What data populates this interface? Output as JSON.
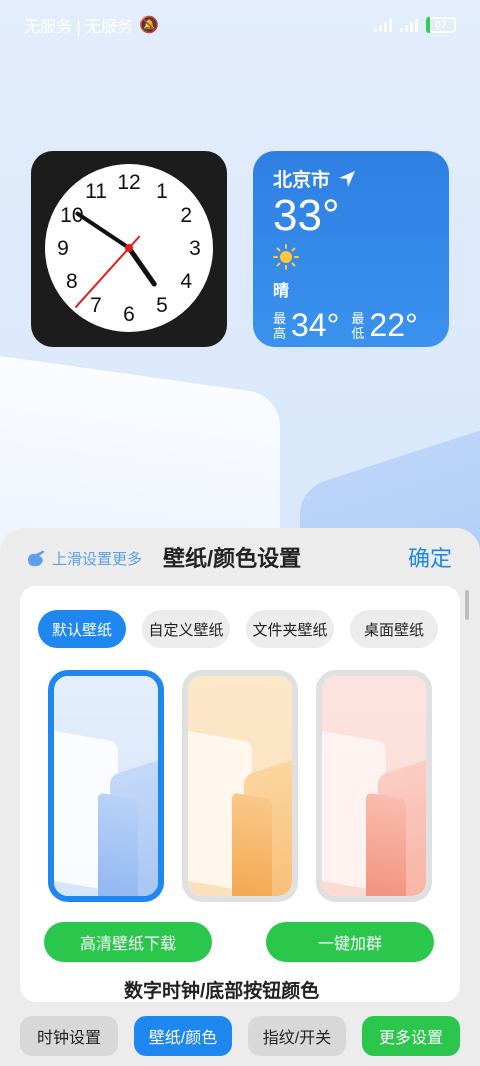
{
  "status_bar": {
    "carrier_text": "无服务 | 无服务",
    "battery": "07"
  },
  "clock_widget": {
    "numerals": [
      "12",
      "1",
      "2",
      "3",
      "4",
      "5",
      "6",
      "7",
      "8",
      "9",
      "10",
      "11"
    ],
    "time": {
      "hour": 4,
      "minute": 50,
      "second": 37
    }
  },
  "weather_widget": {
    "city": "北京市",
    "temperature": "33°",
    "condition": "晴",
    "high_label": "最高",
    "high": "34°",
    "low_label": "最低",
    "low": "22°"
  },
  "panel": {
    "hint": "上滑设置更多",
    "title": "壁纸/颜色设置",
    "confirm": "确定",
    "tabs": [
      {
        "label": "默认壁纸",
        "active": true
      },
      {
        "label": "自定义壁纸",
        "active": false
      },
      {
        "label": "文件夹壁纸",
        "active": false
      },
      {
        "label": "桌面壁纸",
        "active": false
      }
    ],
    "wallpapers": [
      {
        "theme": "blue",
        "selected": true
      },
      {
        "theme": "orange",
        "selected": false
      },
      {
        "theme": "pink",
        "selected": false
      }
    ],
    "download_button": "高清壁纸下载",
    "join_group_button": "一键加群",
    "next_section": "数字时钟/底部按钮颜色"
  },
  "bottom_nav": [
    {
      "label": "时钟设置",
      "style": "gray"
    },
    {
      "label": "壁纸/颜色",
      "style": "blue"
    },
    {
      "label": "指纹/开关",
      "style": "gray"
    },
    {
      "label": "更多设置",
      "style": "green"
    }
  ],
  "colors": {
    "accent_blue": "#1e88f0",
    "accent_green": "#2bc74d",
    "weather_bg": "#2f7fe3"
  }
}
